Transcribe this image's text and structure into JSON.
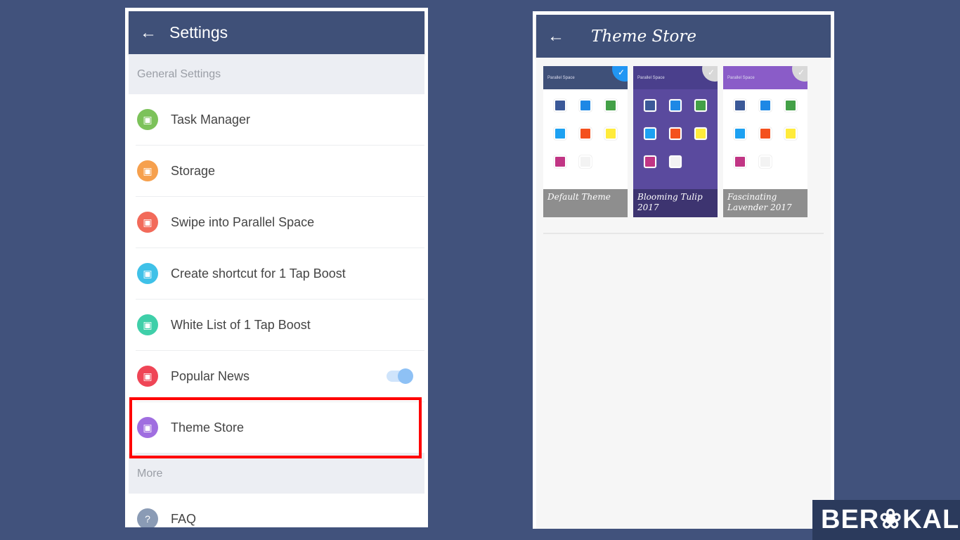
{
  "settings": {
    "title": "Settings",
    "section_general": "General Settings",
    "section_more": "More",
    "items": [
      {
        "label": "Task Manager",
        "icon": "task-manager-icon",
        "color": "#7cc25a"
      },
      {
        "label": "Storage",
        "icon": "storage-icon",
        "color": "#f6a04d"
      },
      {
        "label": "Swipe into Parallel Space",
        "icon": "swipe-icon",
        "color": "#f26a5a"
      },
      {
        "label": "Create shortcut for 1 Tap Boost",
        "icon": "shortcut-icon",
        "color": "#3fc1e8"
      },
      {
        "label": "White List of 1 Tap Boost",
        "icon": "whitelist-icon",
        "color": "#3fcfa9"
      },
      {
        "label": "Popular News",
        "icon": "news-icon",
        "color": "#ef4556",
        "toggle": true
      },
      {
        "label": "Theme Store",
        "icon": "palette-icon",
        "color": "#a06ee0"
      }
    ],
    "faq": "FAQ"
  },
  "theme_store": {
    "title": "Theme Store",
    "app_name": "Parallel Space",
    "themes": [
      {
        "name": "Default Theme",
        "bar": "#3f5078",
        "bg": "#ffffff",
        "cap": "#8e8e8e",
        "selected": true
      },
      {
        "name": "Blooming Tulip 2017",
        "bar": "#4a3f8c",
        "bg": "#5a4a9e",
        "cap": "#3d3470",
        "selected": false
      },
      {
        "name": "Fascinating Lavender 2017",
        "bar": "#8a5cc8",
        "bg": "#ffffff",
        "cap": "#8e8e8e",
        "selected": false
      }
    ]
  },
  "logo": "BERAKAL",
  "accent": "#3f5078",
  "highlight": "#ff0000"
}
